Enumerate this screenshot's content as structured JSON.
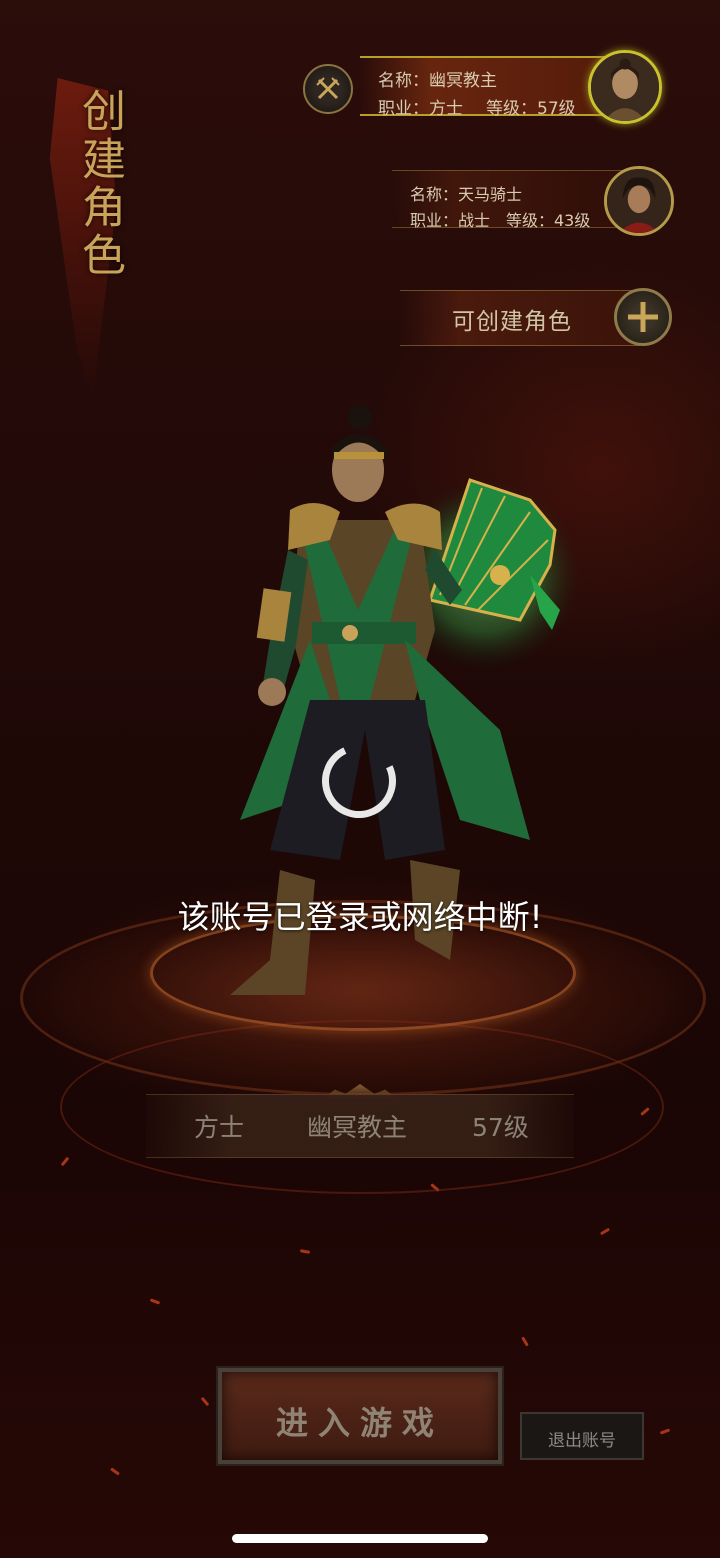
{
  "screen": {
    "title": "创建角色",
    "loading_message": "该账号已登录或网络中断!"
  },
  "roles": [
    {
      "name_line": "名称：幽冥教主",
      "class_line": "职业：方士",
      "level_line": "等级：57级",
      "selected": true
    },
    {
      "name_line": "名称：天马骑士",
      "class_line": "职业：战士",
      "level_line": "等级：43级",
      "selected": false
    }
  ],
  "create_role": {
    "label": "可创建角色"
  },
  "info_bar": {
    "class": "方士",
    "name": "幽冥教主",
    "level": "57级"
  },
  "buttons": {
    "enter_game": "进入游戏",
    "logout": "退出账号"
  },
  "colors": {
    "selected_border": "#b8a028",
    "accent_gold": "#c9a35a",
    "message_text": "#ffffff"
  },
  "icons": {
    "delete": "crossed-swords-icon",
    "create": "plus-icon"
  }
}
